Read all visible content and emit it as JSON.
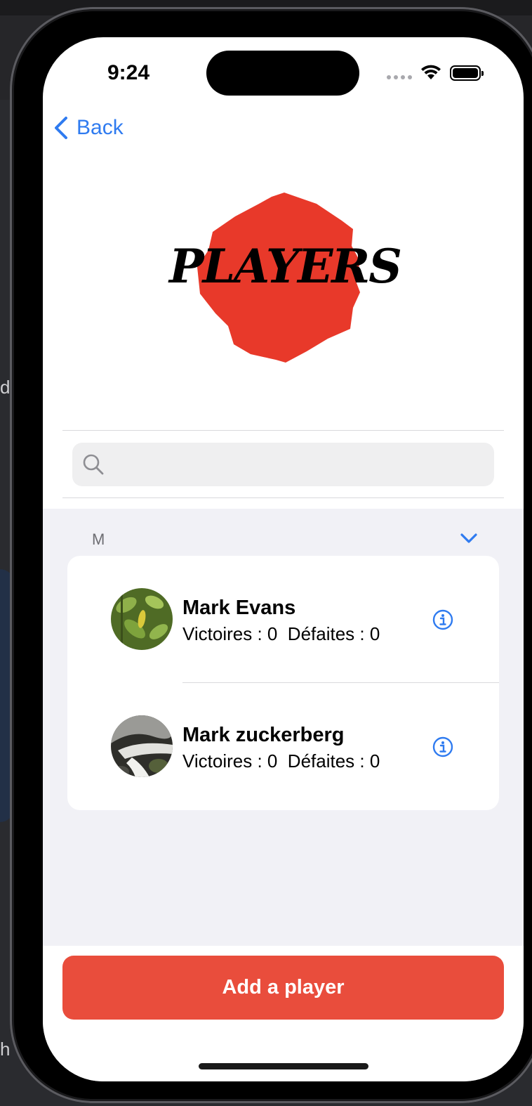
{
  "status_bar": {
    "time": "9:24"
  },
  "nav": {
    "back_label": "Back"
  },
  "logo": {
    "text": "PLAYERS",
    "color": "#e8392a"
  },
  "search": {
    "placeholder": "",
    "value": ""
  },
  "section": {
    "letter": "M"
  },
  "players": [
    {
      "name": "Mark Evans",
      "stats": "Victoires : 0  Défaites : 0"
    },
    {
      "name": "Mark zuckerberg",
      "stats": "Victoires : 0  Défaites : 0"
    }
  ],
  "actions": {
    "add_player_label": "Add a player"
  },
  "desktop": {
    "fragment_1": "d",
    "fragment_2": "h"
  },
  "colors": {
    "accent": "#2f7bf0",
    "button": "#e94d3c",
    "list_bg": "#f1f1f6"
  }
}
